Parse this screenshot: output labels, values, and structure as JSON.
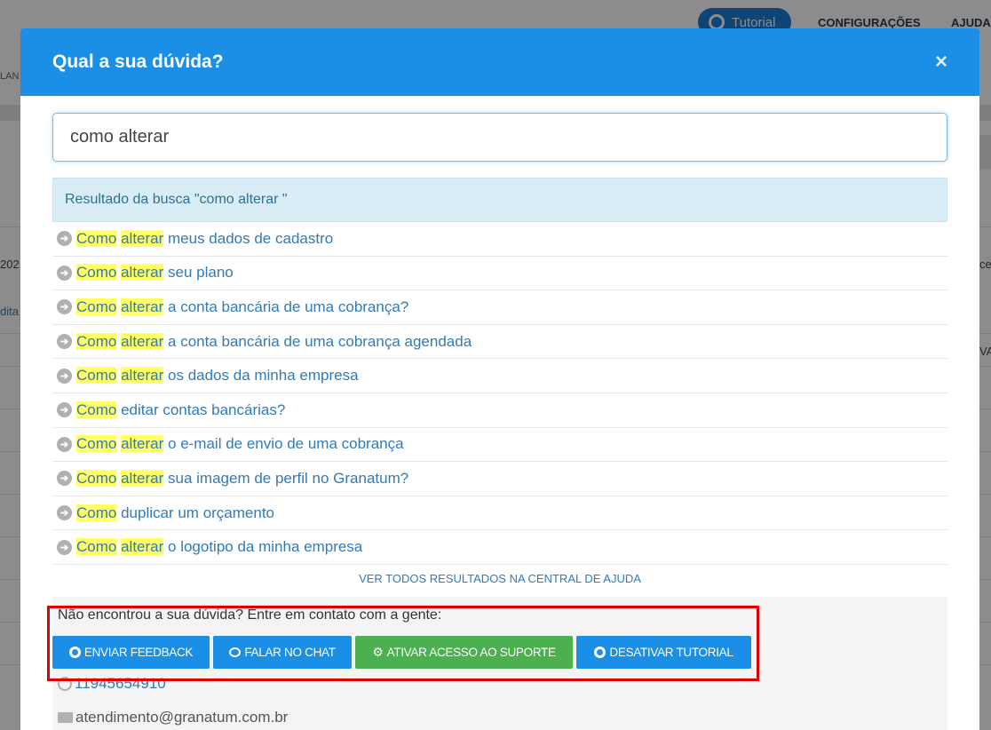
{
  "background": {
    "tutorial_label": "Tutorial",
    "config_label": "CONFIGURAÇÕES",
    "ajuda_label": "AJUDA",
    "left_fragments": [
      "LAN",
      "202",
      "dita"
    ],
    "right_fragments": [
      "ce",
      "VA"
    ]
  },
  "modal": {
    "title": "Qual a sua dúvida?",
    "close_label": "×",
    "search": {
      "value": "como alterar",
      "placeholder": ""
    },
    "result_header": "Resultado da busca \"como alterar \"",
    "results": [
      {
        "hl": [
          "Como",
          "alterar"
        ],
        "rest": "meus dados de cadastro"
      },
      {
        "hl": [
          "Como",
          "alterar"
        ],
        "rest": "seu plano"
      },
      {
        "hl": [
          "Como",
          "alterar"
        ],
        "rest": "a conta bancária de uma cobrança?"
      },
      {
        "hl": [
          "Como",
          "alterar"
        ],
        "rest": "a conta bancária de uma cobrança agendada"
      },
      {
        "hl": [
          "Como",
          "alterar"
        ],
        "rest": "os dados da minha empresa"
      },
      {
        "hl": [
          "Como"
        ],
        "rest": "editar contas bancárias?"
      },
      {
        "hl": [
          "Como",
          "alterar"
        ],
        "rest": "o e-mail de envio de uma cobrança"
      },
      {
        "hl": [
          "Como",
          "alterar"
        ],
        "rest": "sua imagem de perfil no Granatum?"
      },
      {
        "hl": [
          "Como"
        ],
        "rest": "duplicar um orçamento"
      },
      {
        "hl": [
          "Como",
          "alterar"
        ],
        "rest": "o logotipo da minha empresa"
      }
    ],
    "see_all": "VER TODOS RESULTADOS NA CENTRAL DE AJUDA",
    "contact": {
      "question": "Não encontrou a sua dúvida? Entre em contato com a gente:",
      "buttons": {
        "feedback": "ENVIAR FEEDBACK",
        "chat": "FALAR NO CHAT",
        "support": "ATIVAR ACESSO AO SUPORTE",
        "tutorial": "DESATIVAR TUTORIAL"
      },
      "phone": "11945654910",
      "email": "atendimento@granatum.com.br"
    }
  },
  "colors": {
    "header_blue": "#1b8fe6",
    "support_green": "#4caf50",
    "highlight": "#ffff66",
    "annotation_red": "#e00000"
  }
}
